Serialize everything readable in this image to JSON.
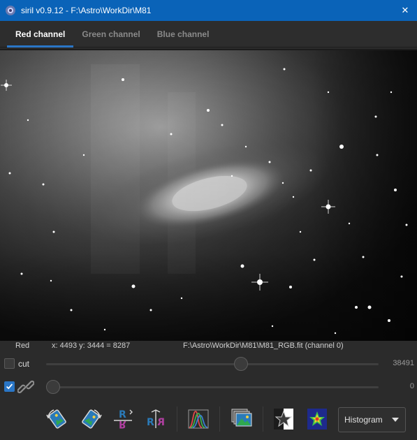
{
  "window": {
    "title": "siril v0.9.12 - F:\\Astro\\WorkDir\\M81",
    "close_glyph": "✕"
  },
  "tabs": [
    {
      "label": "Red channel",
      "active": true
    },
    {
      "label": "Green channel",
      "active": false
    },
    {
      "label": "Blue channel",
      "active": false
    }
  ],
  "statusbar": {
    "channel": "Red",
    "coords": "x: 4493 y: 3444 = 8287",
    "file": "F:\\Astro\\WorkDir\\M81\\M81_RGB.fit (channel 0)"
  },
  "high_slider": {
    "cut_label": "cut",
    "cut_checked": false,
    "value": "38491",
    "level": 0.59
  },
  "low_slider": {
    "link_checked": true,
    "value": "0",
    "level": 0.0
  },
  "toolbar": {
    "display_mode": "Histogram",
    "icons": [
      "rotate-left-icon",
      "rotate-right-icon",
      "mirror-x-icon",
      "mirror-y-icon",
      "histogram-icon",
      "sequence-stack-icon",
      "negative-view-icon",
      "false-color-icon"
    ]
  },
  "colors": {
    "titlebar": "#0a63b8",
    "accent": "#2a76c6",
    "background": "#2b2b2b"
  }
}
